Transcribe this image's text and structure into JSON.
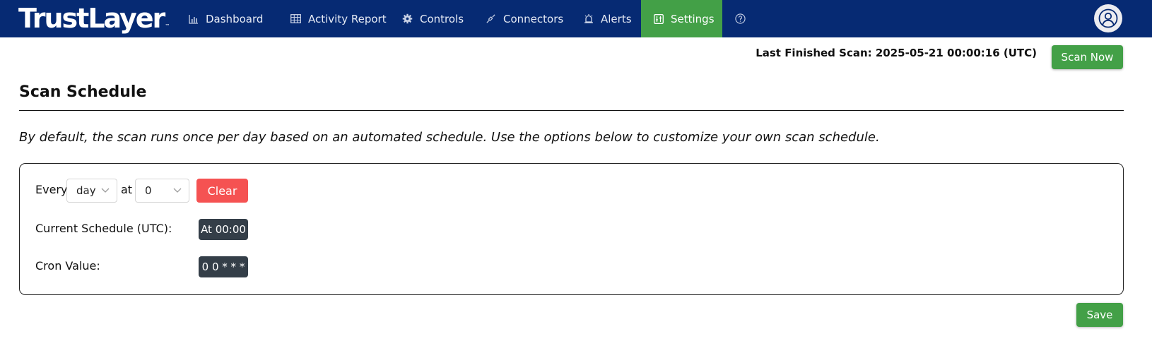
{
  "app": {
    "logo_text": "TrustLayer",
    "logo_mark": "™"
  },
  "nav": {
    "items": [
      {
        "label": "Dashboard",
        "icon": "bar-chart-icon"
      },
      {
        "label": "Activity Report",
        "icon": "table-icon"
      },
      {
        "label": "Controls",
        "icon": "gear-icon"
      },
      {
        "label": "Connectors",
        "icon": "plug-icon"
      },
      {
        "label": "Alerts",
        "icon": "alarm-icon"
      },
      {
        "label": "Settings",
        "icon": "sliders-icon",
        "active": true
      }
    ],
    "help_icon": "help-circle-icon",
    "account_icon": "user-circle-icon"
  },
  "scan": {
    "last_finished": "Last Finished Scan: 2025-05-21 00:00:16 (UTC)",
    "scan_now_label": "Scan Now"
  },
  "schedule": {
    "title": "Scan Schedule",
    "description": "By default, the scan runs once per day based on an automated schedule. Use the options below to customize your own scan schedule.",
    "every_label": "Every",
    "period_value": "day",
    "at_label": "at",
    "hour_value": "0",
    "clear_label": "Clear",
    "current_label": "Current Schedule (UTC):",
    "current_value": "At 00:00",
    "cron_label": "Cron Value:",
    "cron_value": "0 0 * * *",
    "save_label": "Save"
  },
  "colors": {
    "navbar": "#062a73",
    "active": "#43a047",
    "clear": "#f55252",
    "badge": "#343e48"
  }
}
